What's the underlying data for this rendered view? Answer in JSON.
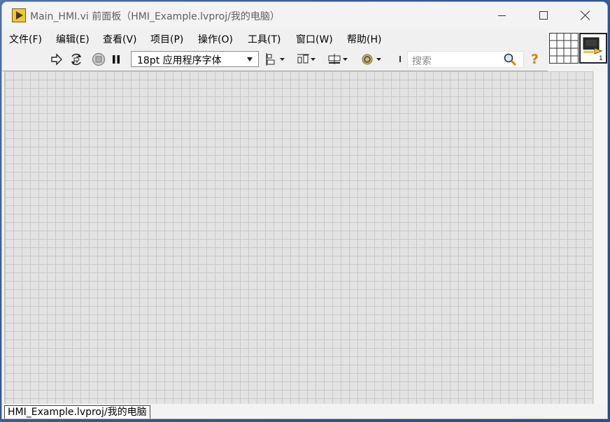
{
  "window": {
    "title": "Main_HMI.vi 前面板（HMI_Example.lvproj/我的电脑）"
  },
  "menus": [
    "文件(F)",
    "编辑(E)",
    "查看(V)",
    "项目(P)",
    "操作(O)",
    "工具(T)",
    "窗口(W)",
    "帮助(H)"
  ],
  "toolbar": {
    "font_select_value": "18pt 应用程序字体",
    "search_placeholder": "搜索",
    "help_label": "?",
    "run_icon": "run-arrow-icon",
    "continuous_icon": "run-continuously-icon",
    "abort_icon": "abort-icon",
    "pause_icon": "pause-icon",
    "align_icon": "align-objects-icon",
    "distribute_icon": "distribute-objects-icon",
    "resize_icon": "resize-objects-icon",
    "reorder_icon": "reorder-icon"
  },
  "status": {
    "context": "HMI_Example.lvproj/我的电脑"
  }
}
